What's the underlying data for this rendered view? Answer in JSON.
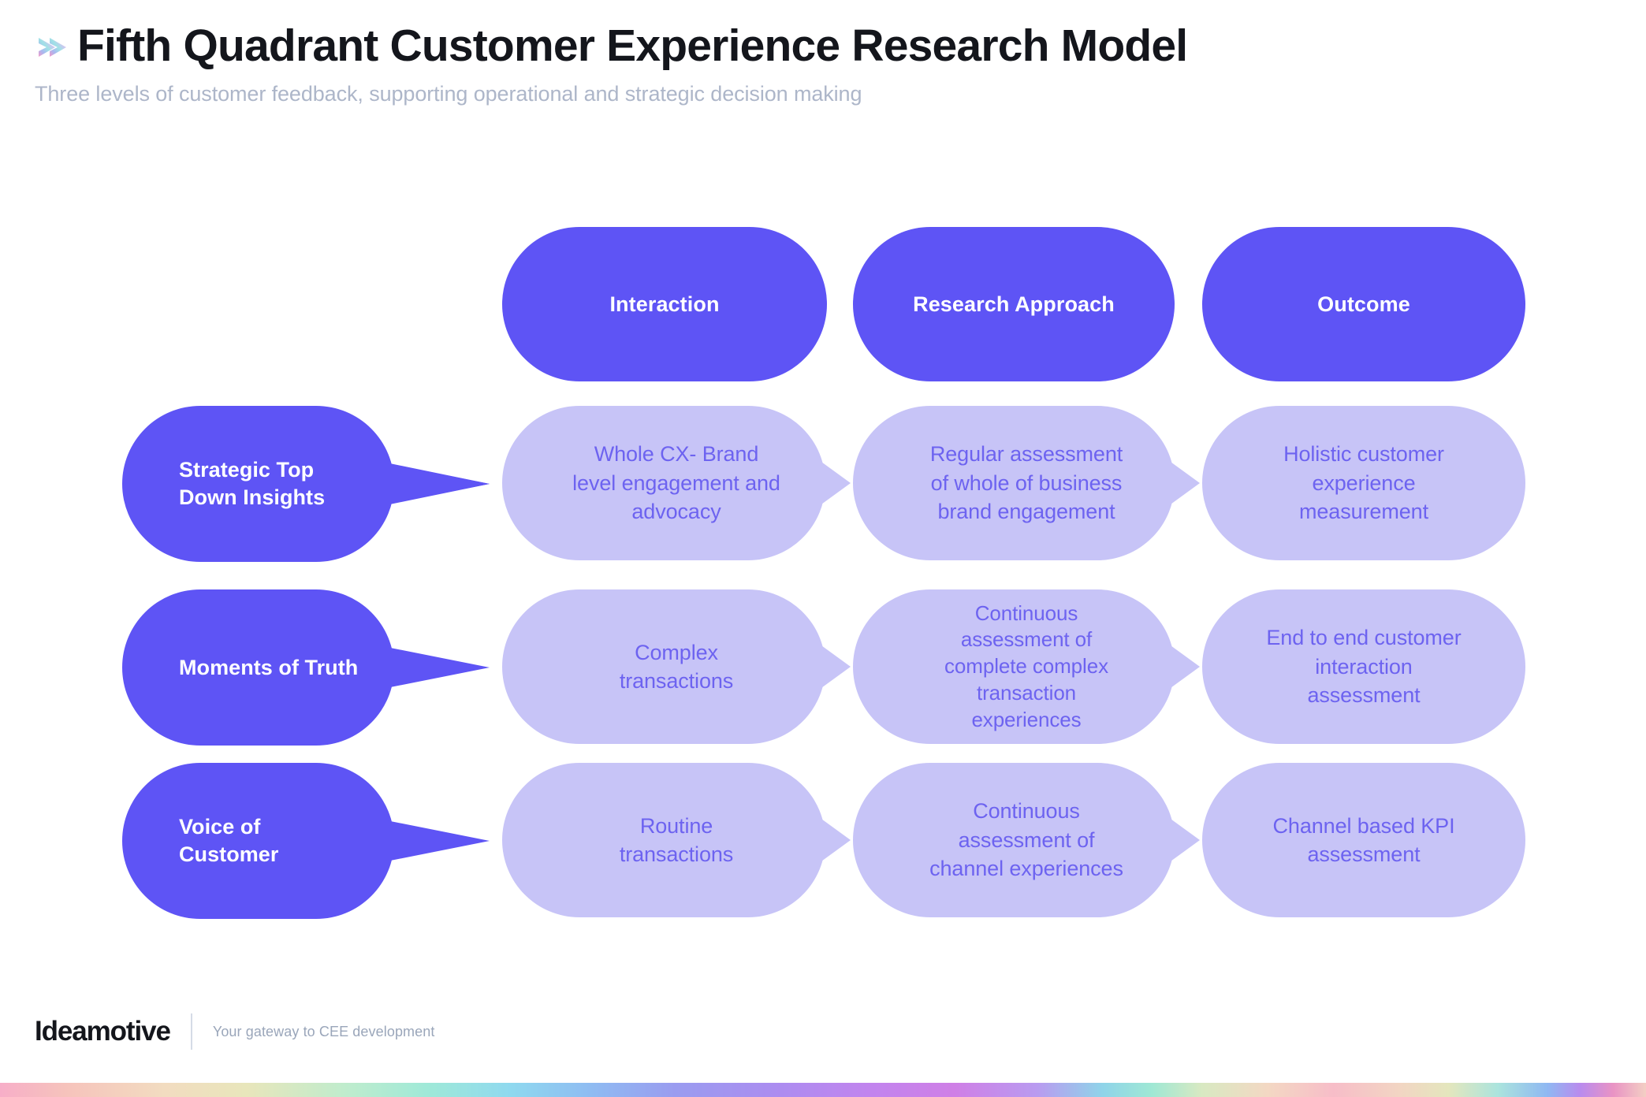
{
  "header": {
    "title": "Fifth Quadrant Customer Experience Research Model",
    "subtitle": "Three levels of customer feedback, supporting operational and strategic decision making",
    "brand_icon": "chevron-right-gradient-icon"
  },
  "colors": {
    "primary": "#5E54F5",
    "light_fill": "#C7C4F7",
    "cell_text": "#6D63F0",
    "title_text": "#14161C",
    "subtitle_text": "#ADB6C9",
    "footer_tagline_text": "#9AA6BA",
    "background": "#FFFFFF"
  },
  "diagram": {
    "type": "matrix",
    "column_headers": [
      {
        "label": "Interaction"
      },
      {
        "label": "Research\nApproach"
      },
      {
        "label": "Outcome"
      }
    ],
    "rows": [
      {
        "label": "Strategic Top\nDown Insights",
        "cells": [
          "Whole CX- Brand\nlevel engagement and\nadvocacy",
          "Regular assessment\nof whole of business\nbrand engagement",
          "Holistic customer\nexperience\nmeasurement"
        ]
      },
      {
        "label": "Moments of Truth",
        "cells": [
          "Complex\ntransactions",
          "Continuous\nassessment of\ncomplete complex\ntransaction\nexperiences",
          "End to end customer\ninteraction\nassessment"
        ]
      },
      {
        "label": "Voice of\nCustomer",
        "cells": [
          "Routine\ntransactions",
          "Continuous\nassessment of\nchannel experiences",
          "Channel based KPI\nassessment"
        ]
      }
    ]
  },
  "footer": {
    "logo": "Ideamotive",
    "tagline": "Your gateway to CEE development"
  }
}
